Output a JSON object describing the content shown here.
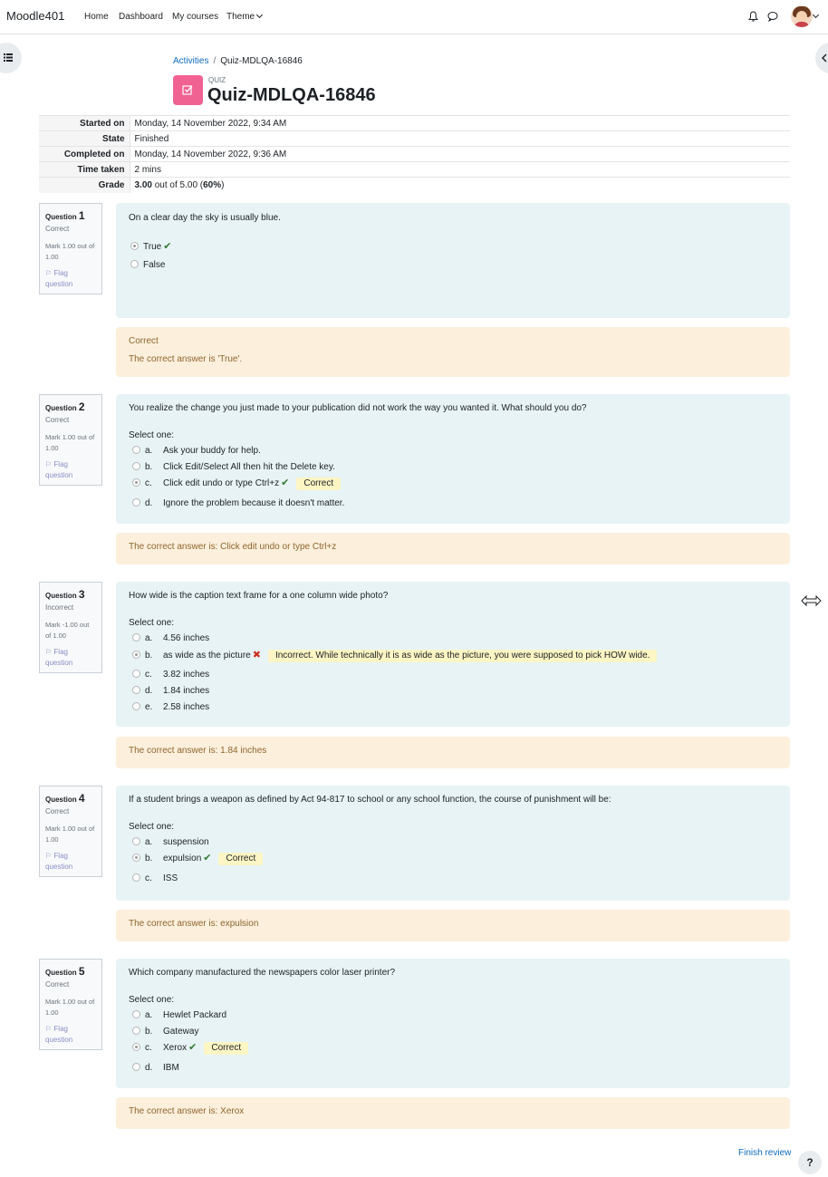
{
  "navbar": {
    "brand": "Moodle401",
    "links": [
      "Home",
      "Dashboard",
      "My courses",
      "Theme"
    ]
  },
  "breadcrumb": {
    "items": [
      "Activities",
      "Quiz-MDLQA-16846"
    ]
  },
  "header": {
    "mod_type": "QUIZ",
    "title": "Quiz-MDLQA-16846"
  },
  "summary": [
    {
      "label": "Started on",
      "value": "Monday, 14 November 2022, 9:34 AM"
    },
    {
      "label": "State",
      "value": "Finished"
    },
    {
      "label": "Completed on",
      "value": "Monday, 14 November 2022, 9:36 AM"
    },
    {
      "label": "Time taken",
      "value": "2 mins"
    }
  ],
  "grade": {
    "label": "Grade",
    "score": "3.00",
    "mid": " out of 5.00 (",
    "pct": "60%",
    "end": ")"
  },
  "questions": [
    {
      "no_label": "Question",
      "no": "1",
      "state": "Correct",
      "mark": "Mark 1.00 out of 1.00",
      "flag": "Flag question",
      "text": "On a clear day the sky is usually blue.",
      "options": [
        {
          "label": "True",
          "checked": true,
          "mark": "tick"
        },
        {
          "label": "False",
          "checked": false
        }
      ],
      "feedback": [
        "Correct",
        "The correct answer is 'True'."
      ]
    },
    {
      "no_label": "Question",
      "no": "2",
      "state": "Correct",
      "mark": "Mark 1.00 out of 1.00",
      "flag": "Flag question",
      "text": "You realize the change you just made to your publication did not work the way you wanted it. What should you do?",
      "prompt": "Select one:",
      "options": [
        {
          "letter": "a.",
          "label": "Ask your buddy for help."
        },
        {
          "letter": "b.",
          "label": "Click Edit/Select All then hit the Delete key."
        },
        {
          "letter": "c.",
          "label": "Click edit undo or type Ctrl+z",
          "checked": true,
          "mark": "tick",
          "badge": "Correct"
        },
        {
          "letter": "d.",
          "label": "Ignore the problem because it doesn't matter."
        }
      ],
      "feedback": [
        "The correct answer is: Click edit undo or type Ctrl+z"
      ]
    },
    {
      "no_label": "Question",
      "no": "3",
      "state": "Incorrect",
      "mark": "Mark -1.00 out of 1.00",
      "flag": "Flag question",
      "text": "How wide is the caption text frame for a one column wide photo?",
      "prompt": "Select one:",
      "options": [
        {
          "letter": "a.",
          "label": "4.56 inches"
        },
        {
          "letter": "b.",
          "label": "as wide as the picture",
          "checked": true,
          "mark": "cross",
          "badge": "Incorrect. While technically it is as wide as the picture, you were supposed to pick HOW wide."
        },
        {
          "letter": "c.",
          "label": "3.82 inches"
        },
        {
          "letter": "d.",
          "label": "1.84 inches"
        },
        {
          "letter": "e.",
          "label": "2.58 inches"
        }
      ],
      "feedback": [
        "The correct answer is: 1.84 inches"
      ]
    },
    {
      "no_label": "Question",
      "no": "4",
      "state": "Correct",
      "mark": "Mark 1.00 out of 1.00",
      "flag": "Flag question",
      "text": "If a student brings a weapon as defined by Act 94-817 to school or any school function, the course of punishment will be:",
      "prompt": "Select one:",
      "options": [
        {
          "letter": "a.",
          "label": "suspension"
        },
        {
          "letter": "b.",
          "label": "expulsion",
          "checked": true,
          "mark": "tick",
          "badge": "Correct"
        },
        {
          "letter": "c.",
          "label": "ISS"
        }
      ],
      "feedback": [
        "The correct answer is: expulsion"
      ]
    },
    {
      "no_label": "Question",
      "no": "5",
      "state": "Correct",
      "mark": "Mark 1.00 out of 1.00",
      "flag": "Flag question",
      "text": "Which company manufactured the newspapers color laser printer?",
      "prompt": "Select one:",
      "options": [
        {
          "letter": "a.",
          "label": "Hewlet Packard"
        },
        {
          "letter": "b.",
          "label": "Gateway"
        },
        {
          "letter": "c.",
          "label": "Xerox",
          "checked": true,
          "mark": "tick",
          "badge": "Correct"
        },
        {
          "letter": "d.",
          "label": "IBM"
        }
      ],
      "feedback": [
        "The correct answer is: Xerox"
      ]
    }
  ],
  "footer": {
    "finish": "Finish review",
    "help": "?"
  }
}
